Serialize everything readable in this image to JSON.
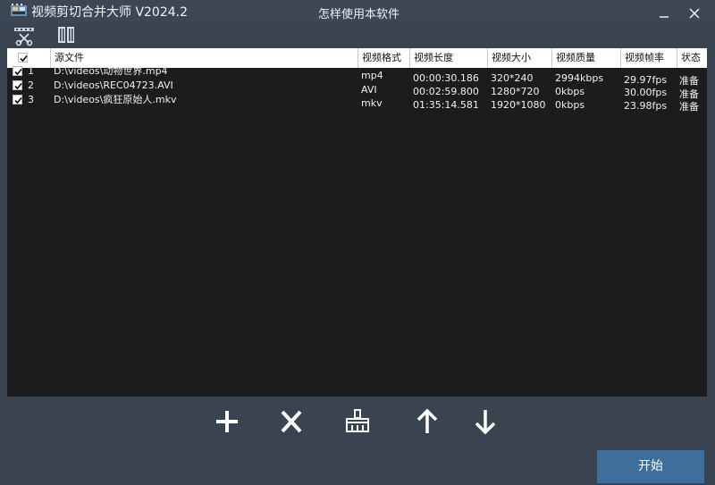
{
  "app": {
    "title": "视频剪切合并大师 V2024.2",
    "help_link": "怎样使用本软件",
    "logo": "film-logo-icon"
  },
  "window_controls": [
    "minimize-icon",
    "close-icon"
  ],
  "toolbar": {
    "tools": [
      {
        "name": "cut",
        "icon": "scissors-film-icon"
      },
      {
        "name": "merge",
        "icon": "merge-film-icon"
      }
    ]
  },
  "table": {
    "headers": {
      "source": "源文件",
      "format": "视频格式",
      "duration": "视频长度",
      "resolution": "视频大小",
      "bitrate": "视频质量",
      "fps": "视频帧率",
      "status": "状态"
    },
    "rows": [
      {
        "index": "1",
        "checked": true,
        "source": "D:\\videos\\动物世界.mp4",
        "format": "mp4",
        "duration": "00:00:30.186",
        "resolution": "320*240",
        "bitrate": "2994kbps",
        "fps": "29.97fps",
        "status": "准备"
      },
      {
        "index": "2",
        "checked": true,
        "source": "D:\\videos\\REC04723.AVI",
        "format": "AVI",
        "duration": "00:02:59.800",
        "resolution": "1280*720",
        "bitrate": "0kbps",
        "fps": "30.00fps",
        "status": "准备"
      },
      {
        "index": "3",
        "checked": true,
        "source": "D:\\videos\\疯狂原始人.mkv",
        "format": "mkv",
        "duration": "01:35:14.581",
        "resolution": "1920*1080",
        "bitrate": "0kbps",
        "fps": "23.98fps",
        "status": "准备"
      }
    ]
  },
  "actions": [
    {
      "name": "add",
      "icon": "plus-icon"
    },
    {
      "name": "remove",
      "icon": "close-x-icon"
    },
    {
      "name": "clear",
      "icon": "broom-icon"
    },
    {
      "name": "move-up",
      "icon": "arrow-up-icon"
    },
    {
      "name": "move-down",
      "icon": "arrow-down-icon"
    }
  ],
  "start_button": "开始",
  "colors": {
    "window_bg": "#3a4450",
    "table_bg": "#1c1c1e",
    "header_bg": "#ffffff",
    "start_button_bg": "#3d6e9c"
  }
}
